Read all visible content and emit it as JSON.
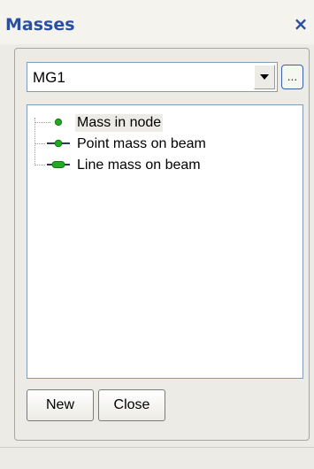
{
  "panel": {
    "title": "Masses",
    "close_glyph": "×"
  },
  "group_select": {
    "value": "MG1",
    "browse_label": "..."
  },
  "tree": {
    "items": [
      {
        "label": "Mass in node",
        "icon": "mass-in-node-icon",
        "selected": true
      },
      {
        "label": "Point mass on beam",
        "icon": "point-mass-beam-icon",
        "selected": false
      },
      {
        "label": "Line mass on beam",
        "icon": "line-mass-beam-icon",
        "selected": false
      }
    ]
  },
  "buttons": {
    "new_label": "New",
    "close_label": "Close"
  },
  "colors": {
    "title": "#2a4f9c",
    "icon_green": "#22aa22",
    "icon_dark": "#2a3a5a"
  }
}
